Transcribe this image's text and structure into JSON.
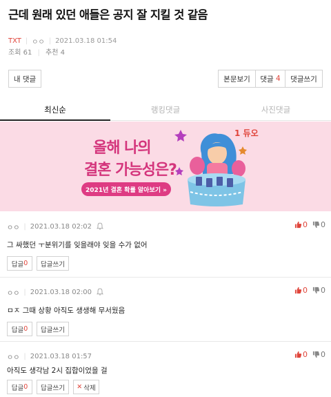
{
  "post": {
    "title": "근데 원래 있던 애들은 공지 잘 지킬 것 같음",
    "category": "TXT",
    "author": "ㅇㅇ",
    "datetime": "2021.03.18 01:54",
    "views_label": "조회",
    "views": "61",
    "recommend_label": "추천",
    "recommend": "4"
  },
  "toolbar": {
    "my_comments": "내 댓글",
    "body_view": "본문보기",
    "comments_label": "댓글",
    "comments_count": "4",
    "write_comment": "댓글쓰기"
  },
  "tabs": [
    {
      "label": "최신순",
      "active": true
    },
    {
      "label": "랭킹댓글",
      "active": false
    },
    {
      "label": "사진댓글",
      "active": false
    }
  ],
  "banner": {
    "line1": "올해 나의",
    "line2": "결혼 가능성은?",
    "cta": "2021년 결혼 확률 알아보기 »",
    "brand": "1 듀오",
    "background": "#fbdbe5",
    "accent": "#d4357c"
  },
  "comments": [
    {
      "author": "ㅇㅇ",
      "datetime": "2021.03.18 02:02",
      "text": "그 싸했던 ㅜ분위기를 잊을래야 잊을 수가 없어",
      "likes": "0",
      "dislikes": "0",
      "reply_label": "답글",
      "reply_count": "0",
      "write_label": "답글쓰기"
    },
    {
      "author": "ㅇㅇ",
      "datetime": "2021.03.18 02:00",
      "text": "ㅁㅈ 그때 상황 아직도 생생해 무서웠음",
      "likes": "0",
      "dislikes": "0",
      "reply_label": "답글",
      "reply_count": "0",
      "write_label": "답글쓰기"
    },
    {
      "author": "ㅇㅇ",
      "datetime": "2021.03.18 01:57",
      "text": "아직도 생각남 2시 집합이었을 걸",
      "likes": "0",
      "dislikes": "0",
      "reply_label": "답글",
      "reply_count": "0",
      "write_label": "답글쓰기",
      "delete_label": "삭제"
    }
  ],
  "colors": {
    "accent_red": "#e0453b",
    "border": "#d2d2d2"
  }
}
